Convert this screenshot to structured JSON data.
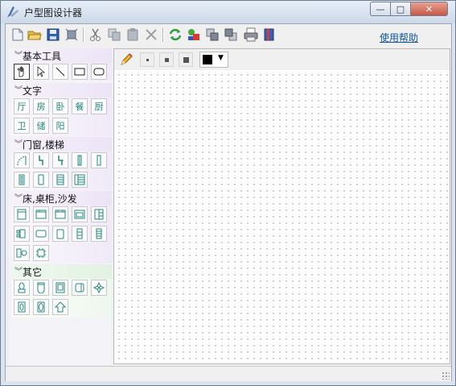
{
  "window": {
    "title": "户型图设计器",
    "caption_buttons": {
      "minimize": "—",
      "maximize": "□",
      "close": "✕"
    }
  },
  "toolbar": {
    "help_link": "使用帮助",
    "buttons": [
      {
        "name": "new-file",
        "icon": "new-file-icon"
      },
      {
        "name": "open-folder",
        "icon": "folder-open-icon"
      },
      {
        "name": "save",
        "icon": "floppy-save-icon"
      },
      {
        "name": "select-frame",
        "icon": "frame-icon"
      },
      {
        "name": "cut",
        "icon": "scissors-icon"
      },
      {
        "name": "copy",
        "icon": "copy-icon"
      },
      {
        "name": "paste",
        "icon": "paste-icon"
      },
      {
        "name": "delete",
        "icon": "delete-x-icon"
      },
      {
        "name": "refresh",
        "icon": "refresh-icon"
      },
      {
        "name": "shapes",
        "icon": "shapes-icon"
      },
      {
        "name": "bring-front",
        "icon": "bring-front-icon"
      },
      {
        "name": "send-back",
        "icon": "send-back-icon"
      },
      {
        "name": "print",
        "icon": "printer-icon"
      },
      {
        "name": "book",
        "icon": "book-icon"
      }
    ]
  },
  "sidebar": {
    "sections": [
      {
        "title": "基本工具",
        "tools": [
          {
            "name": "hand",
            "icon": "hand-icon"
          },
          {
            "name": "pointer",
            "icon": "pointer-icon"
          },
          {
            "name": "line",
            "icon": "line-icon"
          },
          {
            "name": "rectangle",
            "icon": "rectangle-icon"
          },
          {
            "name": "rounded-rect",
            "icon": "rounded-rect-icon"
          }
        ]
      },
      {
        "title": "文字",
        "tools": [
          {
            "name": "living-room",
            "label": "厅"
          },
          {
            "name": "room",
            "label": "房"
          },
          {
            "name": "bedroom",
            "label": "卧"
          },
          {
            "name": "dining",
            "label": "餐"
          },
          {
            "name": "kitchen",
            "label": "厨"
          },
          {
            "name": "bathroom",
            "label": "卫"
          },
          {
            "name": "storage",
            "label": "储"
          },
          {
            "name": "balcony",
            "label": "阳"
          }
        ]
      },
      {
        "title": "门窗,楼梯",
        "tools": [
          {
            "name": "door-arc",
            "icon": "door-arc-icon"
          },
          {
            "name": "door-left",
            "icon": "door-left-icon"
          },
          {
            "name": "door-right",
            "icon": "door-right-icon"
          },
          {
            "name": "window-narrow",
            "icon": "window-narrow-icon"
          },
          {
            "name": "window-tall",
            "icon": "window-tall-icon"
          },
          {
            "name": "window-double",
            "icon": "window-double-icon"
          },
          {
            "name": "window-wide",
            "icon": "window-wide-icon"
          },
          {
            "name": "stairs",
            "icon": "stairs-icon"
          },
          {
            "name": "stairs-turn",
            "icon": "stairs-turn-icon"
          }
        ]
      },
      {
        "title": "床,桌柜,沙发",
        "tools": [
          {
            "name": "bed",
            "icon": "bed-icon"
          },
          {
            "name": "cabinet",
            "icon": "cabinet-icon"
          },
          {
            "name": "wardrobe",
            "icon": "wardrobe-icon"
          },
          {
            "name": "sofa",
            "icon": "sofa-icon"
          },
          {
            "name": "bookshelf",
            "icon": "bookshelf-icon"
          },
          {
            "name": "dining-set",
            "icon": "dining-set-icon"
          },
          {
            "name": "table",
            "icon": "table-icon"
          },
          {
            "name": "chair",
            "icon": "chair-icon"
          },
          {
            "name": "tv-cabinet",
            "icon": "tv-cabinet-icon"
          },
          {
            "name": "shoe-cabinet",
            "icon": "shoe-cabinet-icon"
          },
          {
            "name": "desk-chair",
            "icon": "desk-chair-icon"
          },
          {
            "name": "round-table",
            "icon": "round-table-icon"
          }
        ]
      },
      {
        "title": "其它",
        "tools": [
          {
            "name": "toilet",
            "icon": "toilet-icon"
          },
          {
            "name": "bathtub",
            "icon": "bathtub-icon"
          },
          {
            "name": "shower",
            "icon": "shower-icon"
          },
          {
            "name": "washer",
            "icon": "washer-icon"
          },
          {
            "name": "plant",
            "icon": "plant-icon"
          },
          {
            "name": "sink",
            "icon": "sink-icon"
          },
          {
            "name": "tub-oval",
            "icon": "tub-oval-icon"
          },
          {
            "name": "arrow-up",
            "icon": "arrow-up-icon"
          }
        ]
      }
    ]
  },
  "canvas_toolbar": {
    "pencil_icon": "pencil-icon",
    "pen_sizes": [
      "small",
      "medium",
      "large"
    ],
    "color": "#000000"
  },
  "colors": {
    "accent": "#2a8a82",
    "link": "#1155aa",
    "close": "#c75845"
  }
}
